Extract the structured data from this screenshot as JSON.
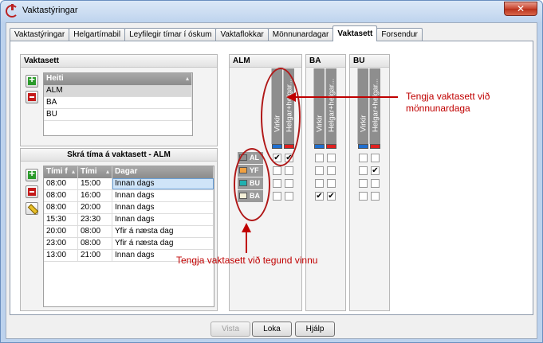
{
  "window": {
    "title": "Vaktastýringar",
    "close": "✕"
  },
  "tabs": [
    "Vaktastýringar",
    "Helgartímabil",
    "Leyfilegir tímar í óskum",
    "Vaktaflokkar",
    "Mönnunardagar",
    "Vaktasett",
    "Forsendur"
  ],
  "vaktasett": {
    "title": "Vaktasett",
    "header": "Heiti",
    "rows": [
      "ALM",
      "BA",
      "BU"
    ]
  },
  "skra": {
    "title": "Skrá tíma á vaktasett - ALM",
    "columns": [
      "Tími f",
      "Tími",
      "Dagar"
    ],
    "rows": [
      [
        "08:00",
        "15:00",
        "Innan dags"
      ],
      [
        "08:00",
        "16:00",
        "Innan dags"
      ],
      [
        "08:00",
        "20:00",
        "Innan dags"
      ],
      [
        "15:30",
        "23:30",
        "Innan dags"
      ],
      [
        "20:00",
        "08:00",
        "Yfir á næsta dag"
      ],
      [
        "23:00",
        "08:00",
        "Yfir á næsta dag"
      ],
      [
        "13:00",
        "21:00",
        "Innan dags"
      ]
    ]
  },
  "matrix": {
    "sets": [
      "ALM",
      "BA",
      "BU"
    ],
    "columns": [
      "Virkir",
      "Helgar+helgar..."
    ],
    "column_colors": [
      "#1f6fd0",
      "#e02020"
    ],
    "rows": [
      {
        "label": "AL",
        "color": "#909090"
      },
      {
        "label": "YF",
        "color": "#f0a040"
      },
      {
        "label": "BU",
        "color": "#20b0b0"
      },
      {
        "label": "BA",
        "color": "#f4f0d8"
      }
    ],
    "check_mark": "✔"
  },
  "annotations": {
    "top": "Tengja vaktasett við mönnunardaga",
    "bottom": "Tengja vaktasett við tegund vinnu"
  },
  "buttons": {
    "vista": "Vista",
    "loka": "Loka",
    "hjalp": "Hjálp"
  }
}
